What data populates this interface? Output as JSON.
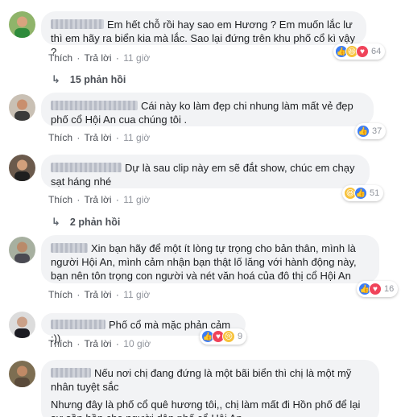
{
  "actions": {
    "like": "Thích",
    "reply": "Trả lời",
    "sep": "·"
  },
  "comments": [
    {
      "text": "Em hết chỗ rồi hay sao em Hương ? Em muốn lắc lư thì em hãy ra biển kia mà lắc. Sao lại đứng trên khu phố cổ kì vậy ?",
      "time": "11 giờ",
      "reaction_count": "64",
      "reactions": [
        "like-icon",
        "haha-icon",
        "love-icon"
      ],
      "replies": "15 phản hồi"
    },
    {
      "text": "Cái này ko làm đẹp chi nhung làm mất vẻ đẹp phố cổ Hội An cua chúng tôi .",
      "time": "11 giờ",
      "reaction_count": "37",
      "reactions": [
        "like-icon"
      ]
    },
    {
      "text": "Dự là sau clip này em sẽ đắt show, chúc em chạy sạt háng nhé",
      "time": "11 giờ",
      "reaction_count": "51",
      "reactions": [
        "haha-icon",
        "like-icon"
      ],
      "replies": "2 phản hồi"
    },
    {
      "text": "Xin bạn hãy để một ít lòng tự trọng cho bản thân, mình là người Hội An, mình cảm nhận bạn thật lố lăng với hành động này, bạn nên tôn trọng con người và nét văn hoá của đô thị cổ Hội An",
      "time": "11 giờ",
      "reaction_count": "16",
      "reactions": [
        "like-icon",
        "love-icon"
      ]
    },
    {
      "text": "Phố cổ mà mặc phản cảm :))",
      "time": "10 giờ",
      "reaction_count": "9",
      "reactions": [
        "like-icon",
        "love-icon",
        "sad-icon"
      ]
    },
    {
      "text_line1": "Nếu nơi chị đang đứng là một bãi biển thì chị là một mỹ nhân tuyệt sắc",
      "text_line2": "Nhưng đây là phố cổ quê hương tôi,, chị làm mất đi Hồn phố để lại sự sần hồn cho người dân phố cổ Hội An."
    }
  ],
  "colors": {
    "like": "#3b7df6",
    "love": "#f0435a",
    "haha": "#f7c23b",
    "bubble": "#f2f3f5"
  }
}
